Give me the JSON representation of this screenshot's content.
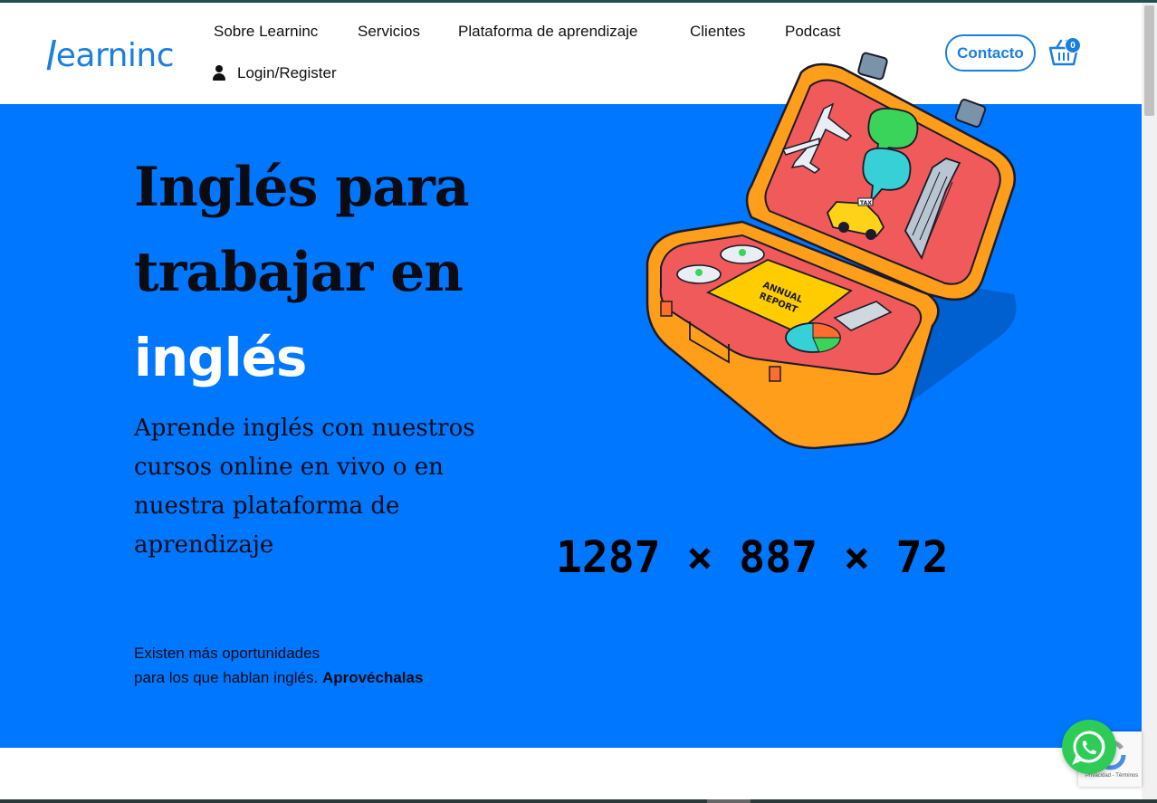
{
  "brand": {
    "logo_text": "earninc",
    "logo_initial": "l"
  },
  "nav": {
    "items": [
      {
        "label": "Sobre Learninc"
      },
      {
        "label": "Servicios"
      },
      {
        "label": "Plataforma de aprendizaje"
      },
      {
        "label": "Clientes"
      },
      {
        "label": "Podcast"
      }
    ],
    "login_label": "Login/Register",
    "contact_label": "Contacto",
    "cart_count": "0"
  },
  "hero": {
    "title_line1": "Inglés para",
    "title_line2": "trabajar en",
    "title_accent": "inglés",
    "subtitle": "Aprende inglés con nuestros cursos online en vivo o en nuestra plataforma de aprendizaje",
    "note_line1": "Existen más oportunidades",
    "note_line2": "para los que hablan inglés.",
    "note_bold": "Aprovéchalas",
    "image_dimensions": "1287 × 887 × 72"
  },
  "illustration": {
    "report_line1": "ANNUAL",
    "report_line2": "REPORT",
    "taxi_label": "TAXI"
  },
  "recaptcha": {
    "text": "Privacidad - Términos"
  },
  "colors": {
    "brand_blue": "#1a7fe0",
    "hero_blue": "#0077ff",
    "whatsapp_green": "#2ecc57",
    "suitcase_orange": "#ff9e1b",
    "suitcase_lining": "#f05a5a"
  },
  "icons": {
    "user": "user-icon",
    "cart": "basket-icon",
    "whatsapp": "whatsapp-icon"
  }
}
